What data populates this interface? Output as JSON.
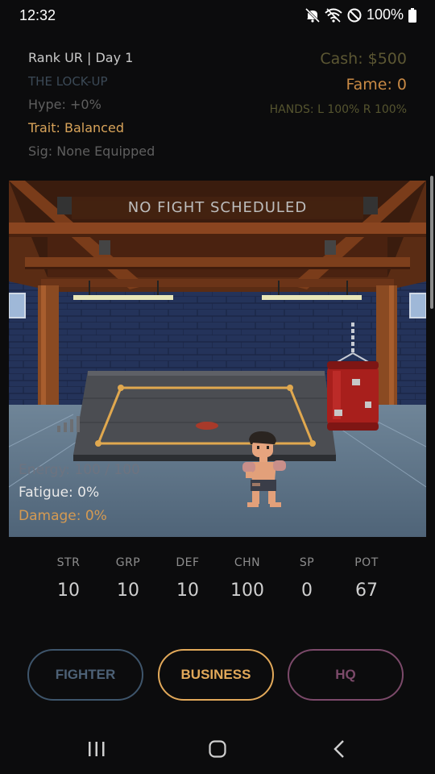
{
  "status_bar": {
    "time": "12:32",
    "battery": "100%"
  },
  "profile": {
    "rank_day": "Rank UR | Day 1",
    "move_name": "THE LOCK-UP",
    "hype": "Hype: +0%",
    "trait": "Trait: Balanced",
    "signature": "Sig: None Equipped"
  },
  "finances": {
    "cash": "Cash: $500",
    "fame": "Fame: 0",
    "hands": "HANDS: L 100%  R 100%"
  },
  "scene": {
    "banner": "NO FIGHT SCHEDULED",
    "energy": "Energy: 100 / 100",
    "fatigue": "Fatigue: 0%",
    "damage": "Damage: 0%"
  },
  "stats": [
    {
      "label": "STR",
      "value": "10"
    },
    {
      "label": "GRP",
      "value": "10"
    },
    {
      "label": "DEF",
      "value": "10"
    },
    {
      "label": "CHN",
      "value": "100"
    },
    {
      "label": "SP",
      "value": "0"
    },
    {
      "label": "POT",
      "value": "67"
    }
  ],
  "buttons": {
    "fighter": "FIGHTER",
    "business": "BUSINESS",
    "hq": "HQ"
  },
  "colors": {
    "background": "#0c0c0d",
    "gold": "#e0a455",
    "olive": "#5c5733",
    "fighter_border": "#3e556b",
    "business_border": "#e2a95a",
    "hq_border": "#7c4a6a"
  }
}
